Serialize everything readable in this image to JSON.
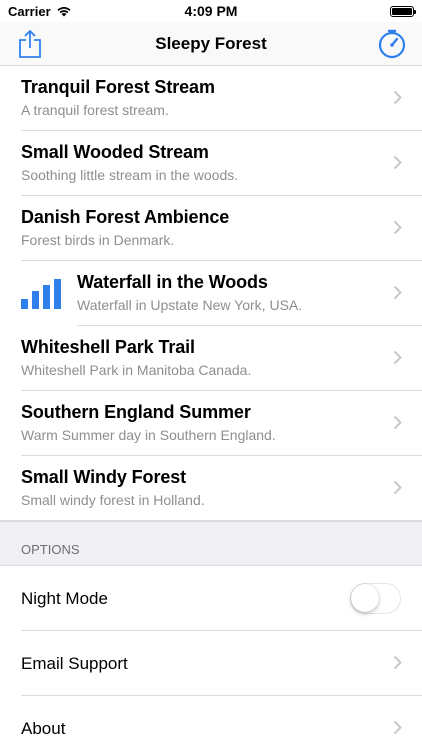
{
  "status_bar": {
    "carrier": "Carrier",
    "time": "4:09 PM"
  },
  "nav": {
    "title": "Sleepy Forest",
    "accent_color": "#2f80ed"
  },
  "sounds": [
    {
      "title": "Tranquil Forest Stream",
      "subtitle": "A tranquil forest stream."
    },
    {
      "title": "Small Wooded Stream",
      "subtitle": "Soothing little stream in the woods."
    },
    {
      "title": "Danish Forest Ambience",
      "subtitle": "Forest birds in Denmark."
    },
    {
      "title": "Waterfall in the Woods",
      "subtitle": "Waterfall in Upstate New York, USA.",
      "playing": true
    },
    {
      "title": "Whiteshell Park Trail",
      "subtitle": "Whiteshell Park in Manitoba Canada."
    },
    {
      "title": "Southern England Summer",
      "subtitle": "Warm Summer day in Southern England."
    },
    {
      "title": "Small Windy Forest",
      "subtitle": "Small windy forest in Holland."
    }
  ],
  "options": {
    "header": "OPTIONS",
    "night_mode": {
      "label": "Night Mode",
      "enabled": false
    },
    "email_support": {
      "label": "Email Support"
    },
    "about": {
      "label": "About"
    }
  }
}
